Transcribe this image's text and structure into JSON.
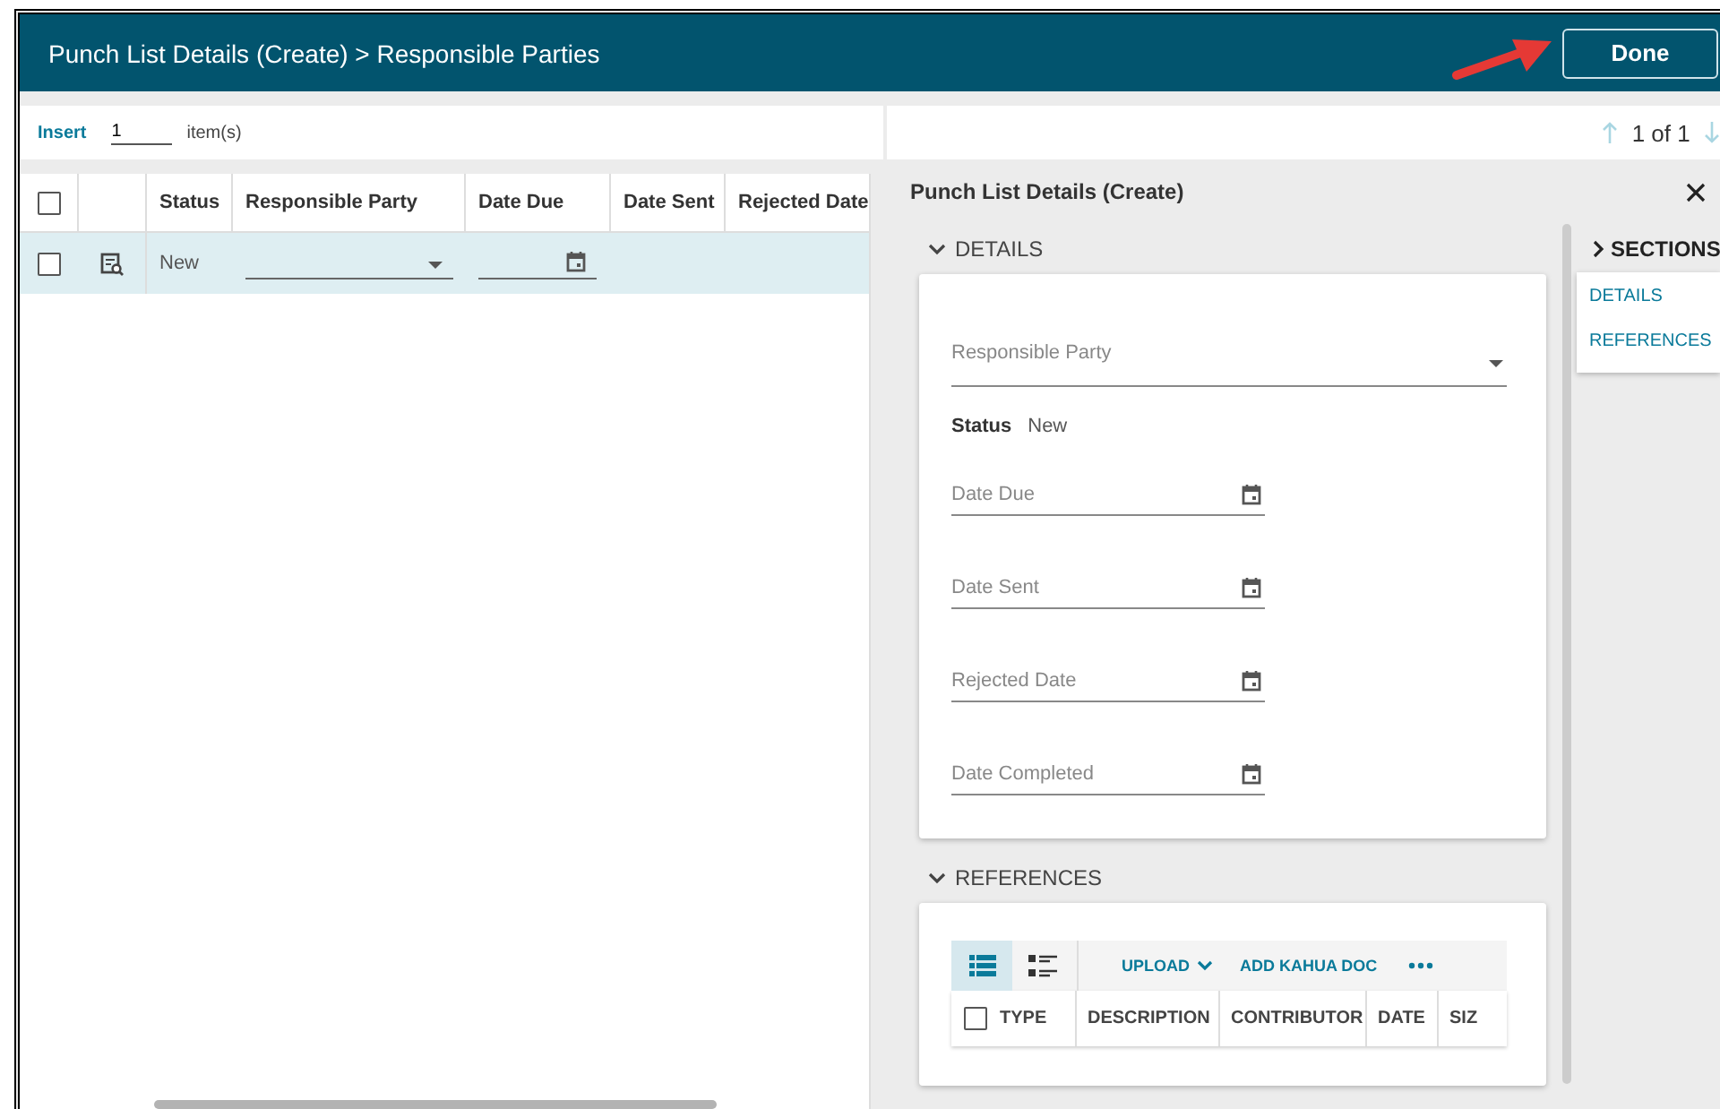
{
  "header": {
    "title": "Punch List Details (Create) > Responsible Parties",
    "done_button": "Done"
  },
  "grid_toolbar": {
    "insert_link": "Insert",
    "count": "1",
    "unit": "item(s)"
  },
  "pager": {
    "text": "1 of 1"
  },
  "grid": {
    "select_all_checked": false,
    "columns": [
      "Status",
      "Responsible Party",
      "Date Due",
      "Date Sent",
      "Rejected Date"
    ],
    "rows": [
      {
        "checked": false,
        "selected": true,
        "status": "New"
      }
    ]
  },
  "detail_panel": {
    "title": "Punch List Details (Create)",
    "details": {
      "heading": "DETAILS",
      "expanded": true,
      "fields": [
        {
          "kind": "select",
          "placeholder": "Responsible Party"
        },
        {
          "kind": "static",
          "label": "Status",
          "value": "New"
        },
        {
          "kind": "date",
          "placeholder": "Date Due"
        },
        {
          "kind": "date",
          "placeholder": "Date Sent"
        },
        {
          "kind": "date",
          "placeholder": "Rejected Date"
        },
        {
          "kind": "date",
          "placeholder": "Date Completed"
        }
      ]
    },
    "references": {
      "heading": "REFERENCES",
      "expanded": true,
      "views": [
        {
          "kind": "list",
          "selected": true
        },
        {
          "kind": "detail",
          "selected": false
        }
      ],
      "actions": [
        {
          "label": "UPLOAD",
          "dropdown": true
        },
        {
          "label": "ADD KAHUA DOC",
          "dropdown": false
        }
      ],
      "select_all_checked": false,
      "columns": [
        "TYPE",
        "DESCRIPTION",
        "CONTRIBUTOR",
        "DATE",
        "SIZ"
      ]
    }
  },
  "sections": {
    "heading": "SECTIONS",
    "expanded": false,
    "items": [
      {
        "label": "DETAILS"
      },
      {
        "label": "REFERENCES"
      }
    ]
  }
}
